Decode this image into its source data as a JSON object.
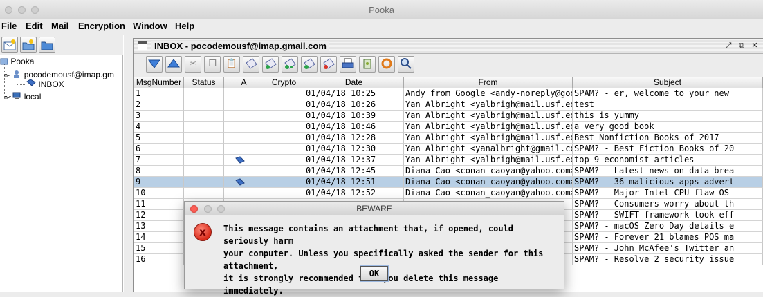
{
  "window": {
    "title": "Pooka"
  },
  "menubar": {
    "items": [
      {
        "label": "File",
        "mnemonic": "F",
        "rest": "ile"
      },
      {
        "label": "Edit",
        "mnemonic": "E",
        "rest": "dit"
      },
      {
        "label": "Mail",
        "mnemonic": "M",
        "rest": "ail"
      },
      {
        "label": "Encryption",
        "mnemonic": "",
        "rest": "Encryption"
      },
      {
        "label": "Window",
        "mnemonic": "W",
        "rest": "indow"
      },
      {
        "label": "Help",
        "mnemonic": "H",
        "rest": "elp"
      }
    ]
  },
  "tree": {
    "root": "Pooka",
    "account": "pocodemousf@imap.gm",
    "inbox": "INBOX",
    "local": "local"
  },
  "inbox_frame": {
    "title": "INBOX - pocodemousf@imap.gmail.com"
  },
  "table": {
    "headers": [
      "MsgNumber",
      "Status",
      "A",
      "Crypto",
      "Date",
      "From",
      "Subject"
    ],
    "selected_row": 9,
    "rows": [
      {
        "num": "1",
        "attach": false,
        "date": "01/04/18 10:25",
        "from": "Andy from Google <andy-noreply@goo...",
        "subject": "SPAM? - er, welcome to your new"
      },
      {
        "num": "2",
        "attach": false,
        "date": "01/04/18 10:26",
        "from": "Yan Albright <yalbrigh@mail.usf.edu>",
        "subject": "test"
      },
      {
        "num": "3",
        "attach": false,
        "date": "01/04/18 10:39",
        "from": "Yan Albright <yalbrigh@mail.usf.edu>",
        "subject": "this is yummy"
      },
      {
        "num": "4",
        "attach": false,
        "date": "01/04/18 10:46",
        "from": "Yan Albright <yalbrigh@mail.usf.edu>",
        "subject": "a very good book"
      },
      {
        "num": "5",
        "attach": false,
        "date": "01/04/18 12:28",
        "from": "Yan Albright <yalbrigh@mail.usf.edu>",
        "subject": "Best Nonfiction Books of 2017"
      },
      {
        "num": "6",
        "attach": false,
        "date": "01/04/18 12:30",
        "from": "Yan Albright <yanalbright@gmail.com>",
        "subject": "SPAM? - Best Fiction Books of 20"
      },
      {
        "num": "7",
        "attach": true,
        "date": "01/04/18 12:37",
        "from": "Yan Albright <yalbrigh@mail.usf.edu>",
        "subject": "top 9 economist articles"
      },
      {
        "num": "8",
        "attach": false,
        "date": "01/04/18 12:45",
        "from": "Diana Cao <conan_caoyan@yahoo.com>",
        "subject": "SPAM? - Latest news on data brea"
      },
      {
        "num": "9",
        "attach": true,
        "date": "01/04/18 12:51",
        "from": "Diana Cao <conan_caoyan@yahoo.com>",
        "subject": "SPAM? - 36 malicious apps advert"
      },
      {
        "num": "10",
        "attach": false,
        "date": "01/04/18 12:52",
        "from": "Diana Cao <conan_caoyan@yahoo.com>",
        "subject": "SPAM? - Major Intel CPU flaw OS-"
      },
      {
        "num": "11",
        "attach": false,
        "date": "",
        "from": ">",
        "subject": "SPAM? - Consumers worry about th"
      },
      {
        "num": "12",
        "attach": false,
        "date": "",
        "from": ">",
        "subject": "SPAM? - SWIFT framework took eff"
      },
      {
        "num": "13",
        "attach": false,
        "date": "",
        "from": ">",
        "subject": "SPAM? - macOS Zero Day details e"
      },
      {
        "num": "14",
        "attach": false,
        "date": "",
        "from": ">",
        "subject": "SPAM? - Forever 21 blames POS ma"
      },
      {
        "num": "15",
        "attach": false,
        "date": "",
        "from": ">",
        "subject": "SPAM? - John McAfee's Twitter an"
      },
      {
        "num": "16",
        "attach": false,
        "date": "",
        "from": ">",
        "subject": "SPAM? - Resolve 2 security issue"
      }
    ]
  },
  "dialog": {
    "title": "BEWARE",
    "icon": "error-x-icon",
    "lines": [
      "This message contains an attachment that, if opened, could seriously harm",
      "your computer.  Unless you specifically asked the sender for this attachment,",
      "it is strongly recommended that you delete this message immediately."
    ],
    "ok_label": "OK"
  },
  "colors": {
    "selection": "#b8cfe5",
    "dialog_close": "#fc5f57",
    "error_icon": "#d92a1a"
  }
}
